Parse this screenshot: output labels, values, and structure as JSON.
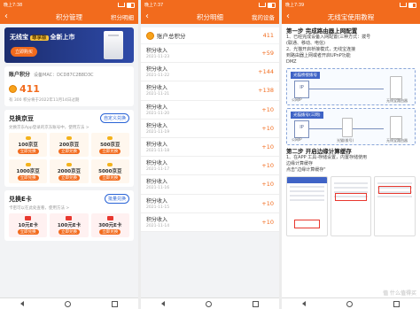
{
  "phone1": {
    "status": {
      "time": "晚上7:38"
    },
    "nav": {
      "title": "积分管理",
      "right": "积分明细"
    },
    "banner": {
      "title_prefix": "无线宝",
      "tag": "尊享版",
      "title_suffix": "全新上市",
      "button": "立即购买"
    },
    "account": {
      "label": "账户积分",
      "mac": "设备MAC：DCD87C2B8D3C",
      "points": "411",
      "note": "有 300 积分将于2022年11月14日过期"
    },
    "jd": {
      "title": "兑换京豆",
      "button": "自定义兑换",
      "sub": "兑换京东App登录的京东账号中，使用方法 >",
      "tiles": [
        {
          "label": "100京豆",
          "btn": "立即兑换"
        },
        {
          "label": "200京豆",
          "btn": "立即兑换"
        },
        {
          "label": "500京豆",
          "btn": "立即兑换"
        },
        {
          "label": "1000京豆",
          "btn": "立即兑换"
        },
        {
          "label": "2000京豆",
          "btn": "立即兑换"
        },
        {
          "label": "5000京豆",
          "btn": "立即兑换"
        }
      ]
    },
    "ecard": {
      "title": "兑换E卡",
      "button": "批量兑换",
      "sub": "卡密可以在此处查看，使用方法 >",
      "tiles": [
        {
          "label": "10元E卡",
          "btn": "立即兑换"
        },
        {
          "label": "100元E卡",
          "btn": "立即兑换"
        },
        {
          "label": "300元E卡",
          "btn": "立即兑换"
        }
      ]
    }
  },
  "phone2": {
    "status": {
      "time": "晚上7:37"
    },
    "nav": {
      "title": "积分明细",
      "right": "我的设备"
    },
    "summary": {
      "label": "账户总积分",
      "value": "411"
    },
    "records": [
      {
        "title": "积分收入",
        "date": "2021-11-23",
        "value": "+59"
      },
      {
        "title": "积分收入",
        "date": "2021-11-22",
        "value": "+144"
      },
      {
        "title": "积分收入",
        "date": "2021-11-21",
        "value": "+138"
      },
      {
        "title": "积分收入",
        "date": "2021-11-20",
        "value": "+10"
      },
      {
        "title": "积分收入",
        "date": "2021-11-19",
        "value": "+10"
      },
      {
        "title": "积分收入",
        "date": "2021-11-18",
        "value": "+10"
      },
      {
        "title": "积分收入",
        "date": "2021-11-17",
        "value": "+10"
      },
      {
        "title": "积分收入",
        "date": "2021-11-16",
        "value": "+10"
      },
      {
        "title": "积分收入",
        "date": "2021-11-15",
        "value": "+10"
      },
      {
        "title": "积分收入",
        "date": "2021-11-14",
        "value": "+10"
      }
    ]
  },
  "phone3": {
    "status": {
      "time": "晚上7:39"
    },
    "nav": {
      "title": "无线宝使用教程"
    },
    "step1": {
      "title": "第一步 完成路由器上网配置",
      "lines": [
        "1、已经完成设备入网配置(三种方式：拨号",
        "(联通、移动、电信)",
        "2、光猫开启桥接模式，无线宝连接",
        "到路由器上网或者开启UPnP功能",
        "DMZ"
      ]
    },
    "diagram1": {
      "header": "光猫桥接拨号",
      "ip": "IP",
      "ip_label": "公网IP",
      "router_label": "无线宝路由器"
    },
    "diagram2": {
      "header": "光猫拨号(三网)",
      "ip": "IP",
      "ip_label": "公网IP",
      "modem_label": "光猫(拨号)",
      "router_label": "无线宝路由器"
    },
    "step2": {
      "title": "第二步 开启边缘计算缓存",
      "lines": [
        "1、在APP 工具-存储设置，内置存储使用",
        "边缘计算缓存",
        "点击\"边缘计算缓存\""
      ]
    },
    "watermark": "值 什么值得买"
  }
}
